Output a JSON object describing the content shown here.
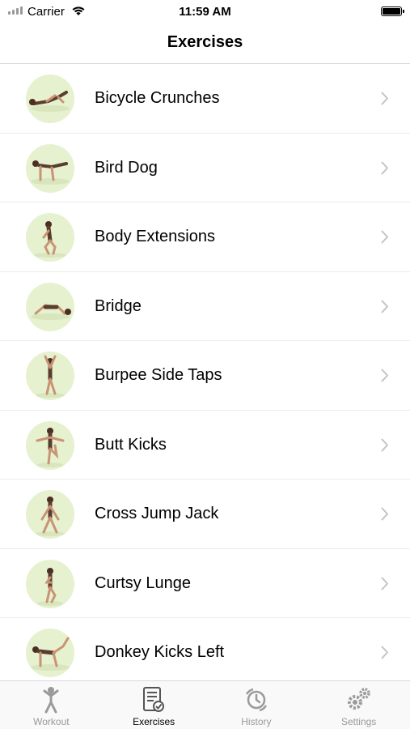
{
  "status_bar": {
    "carrier": "Carrier",
    "time": "11:59 AM"
  },
  "nav": {
    "title": "Exercises"
  },
  "exercises": [
    {
      "label": "Bicycle Crunches",
      "icon": "bicycle-crunches-thumbnail"
    },
    {
      "label": "Bird Dog",
      "icon": "bird-dog-thumbnail"
    },
    {
      "label": "Body Extensions",
      "icon": "body-extensions-thumbnail"
    },
    {
      "label": "Bridge",
      "icon": "bridge-thumbnail"
    },
    {
      "label": "Burpee Side Taps",
      "icon": "burpee-side-taps-thumbnail"
    },
    {
      "label": "Butt Kicks",
      "icon": "butt-kicks-thumbnail"
    },
    {
      "label": "Cross Jump Jack",
      "icon": "cross-jump-jack-thumbnail"
    },
    {
      "label": "Curtsy Lunge",
      "icon": "curtsy-lunge-thumbnail"
    },
    {
      "label": "Donkey Kicks Left",
      "icon": "donkey-kicks-left-thumbnail"
    }
  ],
  "tabs": [
    {
      "label": "Workout",
      "icon": "person-icon",
      "active": false
    },
    {
      "label": "Exercises",
      "icon": "checklist-icon",
      "active": true
    },
    {
      "label": "History",
      "icon": "history-clock-icon",
      "active": false
    },
    {
      "label": "Settings",
      "icon": "gears-icon",
      "active": false
    }
  ],
  "colors": {
    "thumbnail_bg": "#e6f1cf",
    "inactive_tab": "#9a9a9a",
    "chevron": "#c4c4c7"
  }
}
